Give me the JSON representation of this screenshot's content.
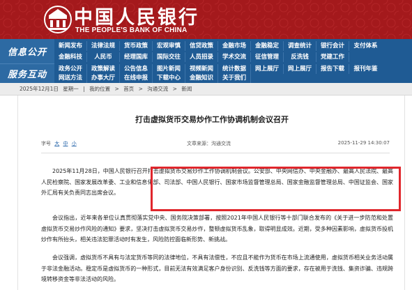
{
  "header": {
    "name_cn": "中国人民银行",
    "name_en": "THE PEOPLE'S BANK OF CHINA",
    "colors": {
      "brand_red": "#a4191c",
      "nav_blue": "#1f5b94"
    }
  },
  "nav": {
    "info_label": "信息公开",
    "service_label": "服务互动",
    "info_row1": [
      "新闻发布",
      "法律法规",
      "货币政策",
      "宏观审慎",
      "信贷政策",
      "金融市场",
      "金融稳定",
      "调查统计",
      "银行会计",
      "支付体系"
    ],
    "info_row2": [
      "金融科技",
      "人民币",
      "经理国库",
      "国际交往",
      "人员招录",
      "学术交流",
      "征信管理",
      "反洗钱",
      "党建工作",
      ""
    ],
    "service_row1": [
      "政务公开",
      "政策解读",
      "公告信息",
      "图片新闻",
      "视频新闻",
      "统计数据",
      "网上展厅",
      "网上展厅",
      "报告下载",
      "报刊年鉴"
    ],
    "service_row2": [
      "网送方法",
      "办事大厅",
      "在线申报",
      "下载中心",
      "金融知识",
      "关于我们",
      "",
      "",
      "",
      ""
    ]
  },
  "breadcrumb": {
    "date": "2025年12月1日",
    "weekday": "星期一",
    "items": [
      "我的位置",
      "首页",
      "沟通交流",
      "新闻"
    ]
  },
  "article": {
    "title": "打击虚拟货币交易炒作工作协调机制会议召开",
    "font_size_label": "字号",
    "font_sizes": [
      "大",
      "中",
      "小"
    ],
    "source": "文章来源：沟通交流",
    "datetime": "2025-11-29 14:30:07",
    "paragraphs": [
      "2025年11月28日，中国人民银行召开打击虚拟货币交易炒作工作协调机制会议。公安部、中央网信办、中央金融办、最高人民法院、最高人民检察院、国家发展改革委、工业和信息化部、司法部、中国人民银行、国家市场监督管理总局、国家金融监督管理总局、中国证监会、国家外汇局有关负责同志出席会议。",
      "会议指出，近年来各单位认真贯彻落实党中央、国务院决策部署，按照2021年中国人民银行等十部门联合发布的《关于进一步防范和处置虚拟货币交易炒作风险的通知》要求，坚决打击虚拟货币交易炒作，整顿虚拟货币乱象，取得明显成效。近期，受多种因素影响，虚拟货币投机炒作有所抬头，相关违法犯罪活动时有发生，风险防控面临新形势、新挑战。",
      "会议强调，虚拟货币不具有与法定货币等同的法律地位，不具有法偿性，不应且不能作为货币在市场上流通使用，虚拟货币相关业务活动属于非法金融活动。稳定币是虚拟货币的一种形式，目前无法有效满足客户身份识别、反洗钱等方面的要求，存在被用于洗钱、集资诈骗、违规跨境转移资金等非法活动的风险。"
    ],
    "highlight_color": "#e0262c"
  }
}
